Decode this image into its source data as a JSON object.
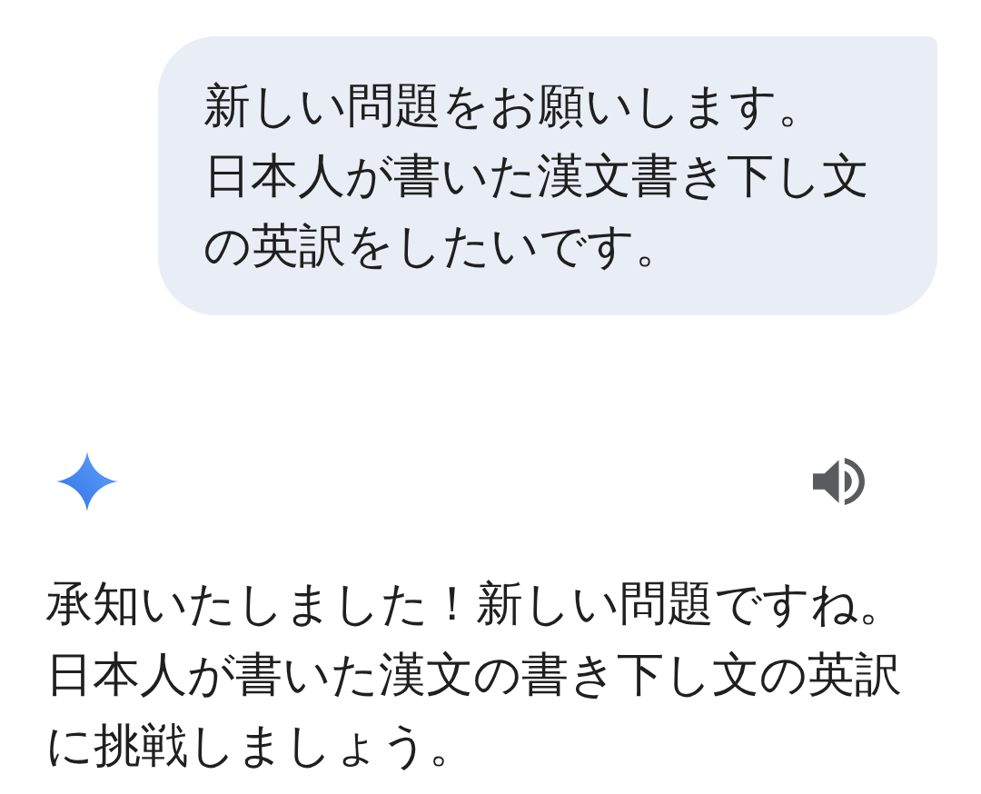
{
  "user_message": {
    "paragraphs": [
      "新しい問題をお願いします。",
      "日本人が書いた漢文書き下し文の英訳をしたいです。"
    ]
  },
  "response": {
    "text": "承知いたしました！新しい問題ですね。日本人が書いた漢文の書き下し文の英訳に挑戦しましょう。"
  }
}
